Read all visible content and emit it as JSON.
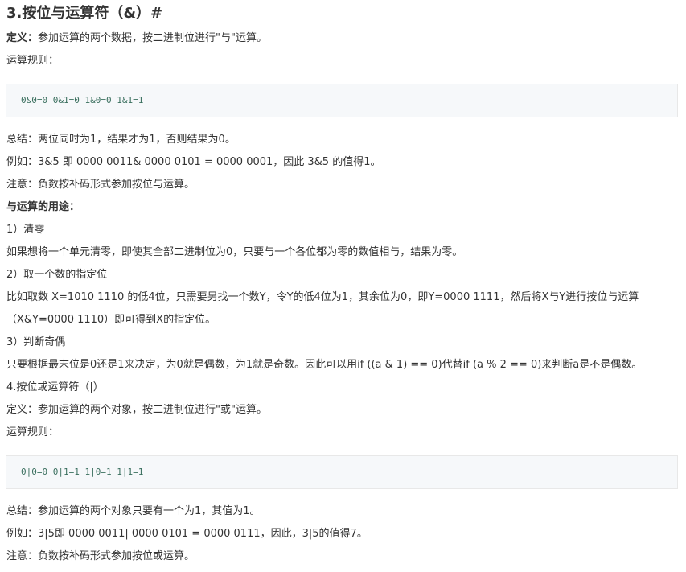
{
  "section3": {
    "title": "3.按位与运算符（&）#",
    "def_label": "定义：",
    "def_text": "参加运算的两个数据，按二进制位进行\"与\"运算。",
    "rules_label": "运算规则：",
    "code": "0&0=0  0&1=0  1&0=0  1&1=1",
    "summary": "总结：两位同时为1，结果才为1，否则结果为0。",
    "example": "例如：3&5 即 0000 0011& 0000 0101 = 0000 0001，因此 3&5 的值得1。",
    "note": "注意：负数按补码形式参加按位与运算。",
    "uses_heading": "与运算的用途：",
    "use1_title": "1）清零",
    "use1_text": "如果想将一个单元清零，即使其全部二进制位为0，只要与一个各位都为零的数值相与，结果为零。",
    "use2_title": "2）取一个数的指定位",
    "use2_text_a": "比如取数 X=1010 1110 的低4位，只需要另找一个数Y，令Y的低4位为1，其余位为0，即Y=0000 1111，然后将X与Y进行按位与运算",
    "use2_text_b": "（X&Y=0000 1110）即可得到X的指定位。",
    "use3_title": "3）判断奇偶",
    "use3_text": "只要根据最末位是0还是1来决定，为0就是偶数，为1就是奇数。因此可以用if ((a & 1) == 0)代替if (a % 2 == 0)来判断a是不是偶数。"
  },
  "section4": {
    "title": "4.按位或运算符（|）",
    "def_label": "定义：",
    "def_text": "参加运算的两个对象，按二进制位进行\"或\"运算。",
    "rules_label": "运算规则：",
    "code": "0|0=0  0|1=1  1|0=1  1|1=1",
    "summary": "总结：参加运算的两个对象只要有一个为1，其值为1。",
    "example": "例如：3|5即 0000 0011| 0000 0101 = 0000 0111，因此，3|5的值得7。",
    "note": "注意：负数按补码形式参加按位或运算。"
  }
}
